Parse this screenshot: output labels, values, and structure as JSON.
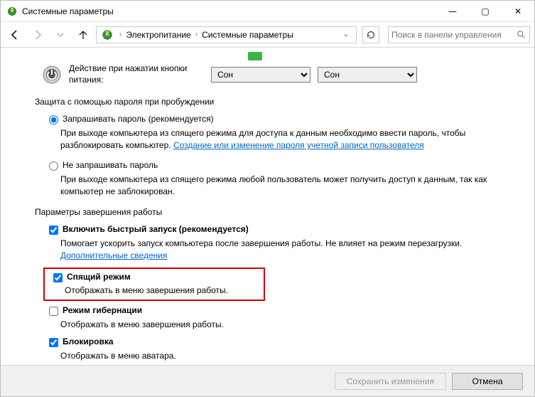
{
  "window": {
    "title": "Системные параметры"
  },
  "sysbuttons": {
    "min": "—",
    "max": "▢",
    "close": "✕"
  },
  "breadcrumb": {
    "item1": "Электропитание",
    "item2": "Системные параметры"
  },
  "search": {
    "placeholder": "Поиск в панели управления"
  },
  "powerAction": {
    "label": "Действие при нажатии кнопки питания:",
    "selected1": "Сон",
    "selected2": "Сон"
  },
  "wakeProtect": {
    "title": "Защита с помощью пароля при пробуждении",
    "opt1": {
      "label": "Запрашивать пароль (рекомендуется)",
      "desc_a": "При выходе компьютера из спящего режима для доступа к данным необходимо ввести пароль, чтобы разблокировать компьютер. ",
      "link": "Создание или изменение пароля учетной записи пользователя"
    },
    "opt2": {
      "label": "Не запрашивать пароль",
      "desc": "При выходе компьютера из спящего режима любой пользователь может получить доступ к данным, так как компьютер не заблокирован."
    }
  },
  "shutdown": {
    "title": "Параметры завершения работы",
    "fast": {
      "label": "Включить быстрый запуск (рекомендуется)",
      "desc_a": "Помогает ускорить запуск компьютера после завершения работы. Не влияет на режим перезагрузки. ",
      "link": "Дополнительные сведения"
    },
    "sleep": {
      "label": "Спящий режим",
      "desc": "Отображать в меню завершения работы."
    },
    "hiber": {
      "label": "Режим гибернации",
      "desc": "Отображать в меню завершения работы."
    },
    "lock": {
      "label": "Блокировка",
      "desc": "Отображать в меню аватара."
    }
  },
  "footer": {
    "save": "Сохранить изменения",
    "cancel": "Отмена"
  }
}
